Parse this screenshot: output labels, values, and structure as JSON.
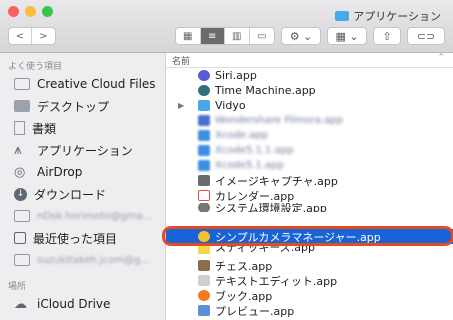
{
  "window": {
    "title": "アプリケーション",
    "traffic_colors": [
      "#fc605c",
      "#fdbc40",
      "#34c749"
    ]
  },
  "toolbar": {
    "back_label": "<",
    "forward_label": ">",
    "views": [
      "icon-view-icon",
      "list-view-icon",
      "column-view-icon",
      "gallery-view-icon"
    ],
    "active_view": "list-view-icon"
  },
  "sidebar": {
    "section_favorites": "よく使う項目",
    "section_places": "場所",
    "items": [
      {
        "label": "Creative Cloud Files",
        "icon": "folder-icon"
      },
      {
        "label": "デスクトップ",
        "icon": "desktop-icon"
      },
      {
        "label": "書類",
        "icon": "document-icon"
      },
      {
        "label": "アプリケーション",
        "icon": "applications-icon"
      },
      {
        "label": "AirDrop",
        "icon": "airdrop-icon"
      },
      {
        "label": "ダウンロード",
        "icon": "download-icon"
      },
      {
        "label": "nDsk.horimoto@gma...",
        "icon": "folder-icon"
      },
      {
        "label": "最近使った項目",
        "icon": "recents-icon"
      },
      {
        "label": "suzukitakeh.jcom@g...",
        "icon": "folder-icon"
      },
      {
        "label": "iCloud Drive",
        "icon": "cloud-icon"
      }
    ],
    "active_index": 3
  },
  "content": {
    "column_name": "名前",
    "rows": [
      {
        "label": "Siri.app",
        "color": "#5b5bd6"
      },
      {
        "label": "Time Machine.app",
        "color": "#2f6f7e"
      },
      {
        "label": "Vidyo",
        "color": "#49a9e8",
        "folder": true
      },
      {
        "label": "Wondershare Filmora.app",
        "color": "#4a6fd0",
        "blurred": true
      },
      {
        "label": "Xcode.app",
        "color": "#3b8fe0",
        "blurred": true
      },
      {
        "label": "Xcode5.1.1.app",
        "color": "#3b8fe0",
        "blurred": true
      },
      {
        "label": "Xcode5.1.app",
        "color": "#3b8fe0",
        "blurred": true
      },
      {
        "label": "イメージキャプチャ.app",
        "color": "#6b6b6b"
      },
      {
        "label": "カレンダー.app",
        "color": "#e24c3f"
      },
      {
        "label": "システム環境設定.app",
        "color": "#777"
      },
      {
        "label": "シンプルカメラマネージャー.app",
        "color": "#f1c232",
        "selected": true
      },
      {
        "label": "スティッキーズ.app",
        "color": "#f3d64a"
      },
      {
        "label": "チェス.app",
        "color": "#8a6d4b"
      },
      {
        "label": "テキストエディット.app",
        "color": "#cfcfcf"
      },
      {
        "label": "ブック.app",
        "color": "#f27b21"
      },
      {
        "label": "プレビュー.app",
        "color": "#5c8fd6"
      }
    ]
  },
  "highlight_color": "#e8491d"
}
